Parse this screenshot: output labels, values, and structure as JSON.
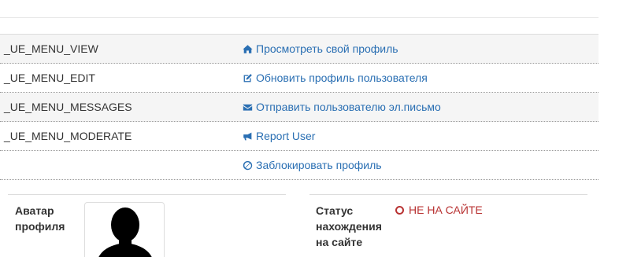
{
  "menu": [
    {
      "key": "_UE_MENU_VIEW",
      "action": "Просмотреть свой профиль",
      "icon": "home-icon"
    },
    {
      "key": "_UE_MENU_EDIT",
      "action": "Обновить профиль пользователя",
      "icon": "edit-icon"
    },
    {
      "key": "_UE_MENU_MESSAGES",
      "action": "Отправить пользователю эл.письмо",
      "icon": "envelope-icon"
    },
    {
      "key": "_UE_MENU_MODERATE",
      "action": "Report User",
      "icon": "bullhorn-icon"
    },
    {
      "key": "",
      "action": "Заблокировать профиль",
      "icon": "ban-icon"
    }
  ],
  "profile": {
    "avatar_label": "Аватар профиля",
    "status_label": "Статус нахождения на сайте",
    "status_value": "НЕ НА САЙТЕ"
  },
  "colors": {
    "link": "#2a6fb3",
    "offline": "#b83232",
    "row_alt": "#f5f5f5"
  }
}
